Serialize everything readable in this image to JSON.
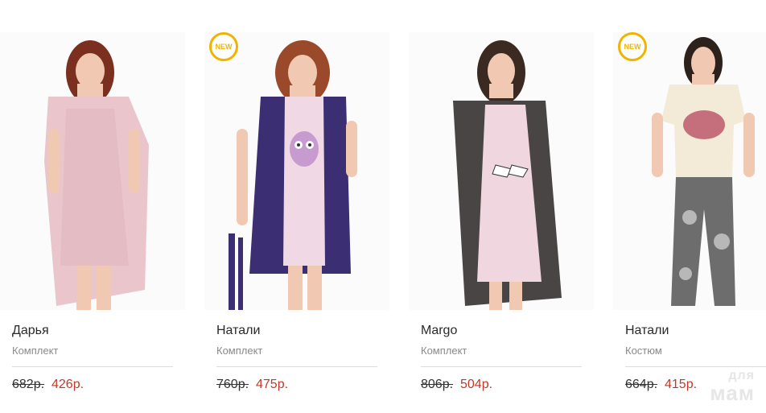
{
  "products": [
    {
      "name": "Дарья",
      "type": "Комплект",
      "old_price": "682р.",
      "new_price": "426р.",
      "badge": "",
      "image": "model-pink-nightgown-robe"
    },
    {
      "name": "Натали",
      "type": "Комплект",
      "old_price": "760р.",
      "new_price": "475р.",
      "badge": "NEW",
      "image": "model-owl-nightgown-navy-robe"
    },
    {
      "name": "Margo",
      "type": "Комплект",
      "old_price": "806р.",
      "new_price": "504р.",
      "badge": "",
      "image": "model-gray-robe-nightgown"
    },
    {
      "name": "Натали",
      "type": "Костюм",
      "old_price": "664р.",
      "new_price": "415р.",
      "badge": "NEW",
      "image": "model-tshirt-floral-pants"
    }
  ],
  "watermark": {
    "line1": "для",
    "line2": "мам"
  },
  "colors": {
    "badge": "#f0b400",
    "sale_price": "#c0392b",
    "muted": "#8a8a8a"
  }
}
